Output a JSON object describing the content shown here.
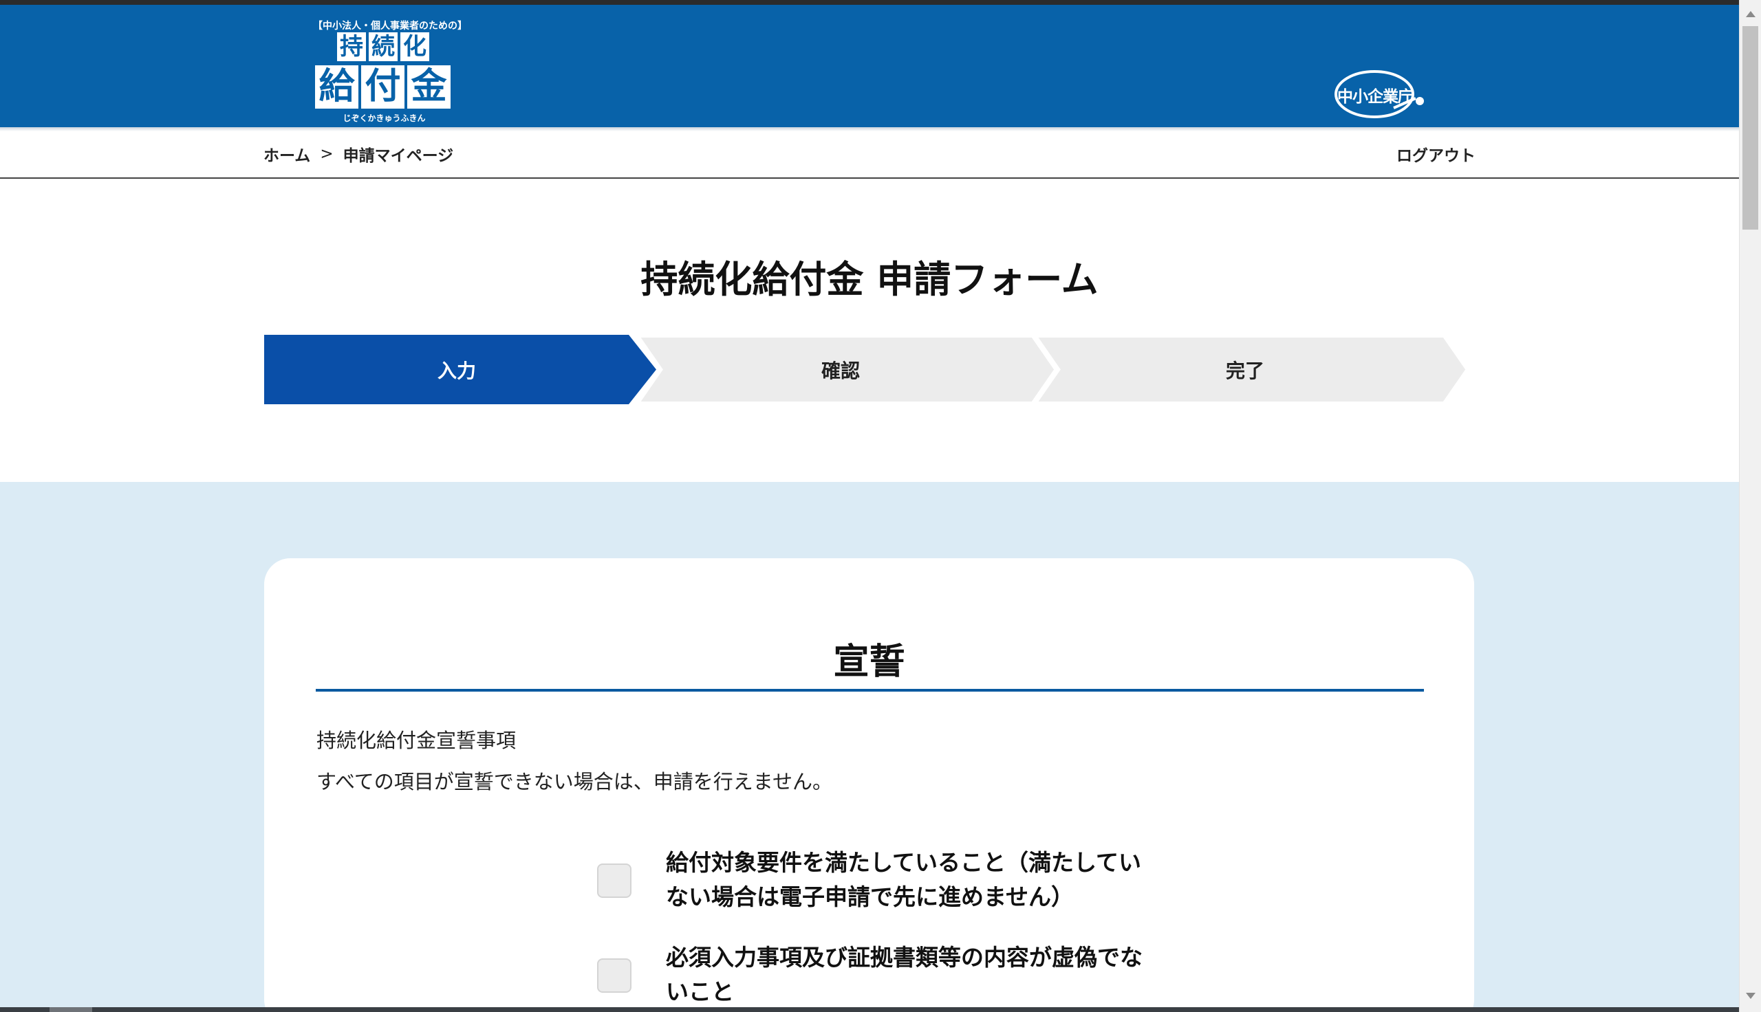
{
  "header": {
    "logo": {
      "tagline": "【中小法人・個人事業者のための】",
      "row1": [
        "持",
        "続",
        "化"
      ],
      "row2": [
        "給",
        "付",
        "金"
      ],
      "reading": "じぞくかきゅうふきん"
    },
    "agency_logo_text": "中小企業庁"
  },
  "nav": {
    "breadcrumb": {
      "home": "ホーム",
      "separator": ">",
      "current": "申請マイページ"
    },
    "logout_label": "ログアウト"
  },
  "page": {
    "title": "持続化給付金 申請フォーム"
  },
  "stepper": {
    "steps": [
      {
        "label": "入力",
        "state": "active"
      },
      {
        "label": "確認",
        "state": "inactive"
      },
      {
        "label": "完了",
        "state": "inactive"
      }
    ],
    "active_color": "#0a4fa8",
    "inactive_color": "#ececec"
  },
  "declaration": {
    "title": "宣誓",
    "intro_heading": "持続化給付金宣誓事項",
    "intro_note": "すべての項目が宣誓できない場合は、申請を行えません。",
    "items": [
      {
        "text": "給付対象要件を満たしていること（満たしていない場合は電子申請で先に進めません）",
        "checked": false
      },
      {
        "text": "必須入力事項及び証拠書類等の内容が虚偽でないこと",
        "checked": false
      }
    ]
  },
  "colors": {
    "header_blue": "#0862a9",
    "content_bg": "#dbebf5"
  }
}
